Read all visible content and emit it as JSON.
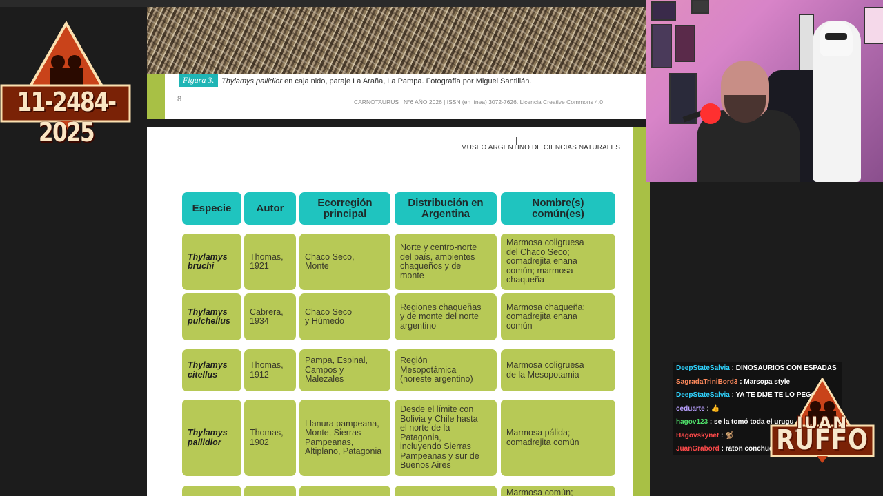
{
  "overlay": {
    "phone_number": "11-2484-2025",
    "channel_logo": {
      "line1": "JUAN",
      "line2": "RUFFO"
    }
  },
  "document_top": {
    "figure_label": "Figura 3.",
    "caption_species": "Thylamys pallidior",
    "caption_rest": " en caja nido, paraje La Araña, La Pampa. Fotografía por Miguel Santillán.",
    "page_number": "8",
    "footer": "CARNOTAURUS | N°6 AÑO 2026 | ISSN (en línea) 3072-7626. Licencia Creative Commons 4.0"
  },
  "document_main": {
    "museum": "MUSEO ARGENTINO DE CIENCIAS NATURALES",
    "table": {
      "headers": [
        "Especie",
        "Autor",
        "Ecorregión\nprincipal",
        "Distribución en\nArgentina",
        "Nombre(s)\ncomún(es)"
      ],
      "rows": [
        {
          "species": "Thylamys\nbruchi",
          "author": "Thomas,\n1921",
          "ecoregion": "Chaco Seco,\nMonte",
          "distribution": "Norte y centro-norte\ndel país, ambientes\nchaqueños y de\nmonte",
          "common": "Marmosa coligruesa\ndel Chaco Seco;\ncomadrejita enana\ncomún; marmosa\nchaqueña"
        },
        {
          "species": "Thylamys\npulchellus",
          "author": "Cabrera,\n1934",
          "ecoregion": "Chaco Seco\ny Húmedo",
          "distribution": "Regiones chaqueñas\ny de monte del norte\nargentino",
          "common": "Marmosa chaqueña;\ncomadrejita enana\ncomún"
        },
        {
          "species": "Thylamys\ncitellus",
          "author": "Thomas,\n1912",
          "ecoregion": "Pampa, Espinal,\nCampos y\nMalezales",
          "distribution": "Región\nMesopotámica\n(noreste argentino)",
          "common": "Marmosa coligruesa\nde la Mesopotamia"
        },
        {
          "species": "Thylamys\npallidior",
          "author": "Thomas,\n1902",
          "ecoregion": "Llanura pampeana,\nMonte, Sierras\nPampeanas,\nAltiplano, Patagonia",
          "distribution": "Desde el límite con\nBolivia y Chile hasta\nel norte de la\nPatagonia,\nincluyendo Sierras\nPampeanas y sur de\nBuenos Aires",
          "common": "Marmosa pálida;\ncomadrejita común"
        },
        {
          "species": "",
          "author": "",
          "ecoregion": "",
          "distribution": "",
          "common": "Marmosa común;"
        }
      ]
    }
  },
  "chat": [
    {
      "user": "DeepStateSalvia",
      "color": "#2fd4ff",
      "message": "DINOSAURIOS CON ESPADAS"
    },
    {
      "user": "SagradaTriniBord3",
      "color": "#ff8a5c",
      "message": "Marsopa style"
    },
    {
      "user": "DeepStateSalvia",
      "color": "#2fd4ff",
      "message": "YA TE DIJE TE LO PEGO"
    },
    {
      "user": "ceduarte",
      "color": "#b9a0ff",
      "message": "👍"
    },
    {
      "user": "hagov123",
      "color": "#4fe06a",
      "message": "se la tomó toda el urugu"
    },
    {
      "user": "Hagovskynet",
      "color": "#ff4a4a",
      "message": "🐒"
    },
    {
      "user": "JuanGrabord",
      "color": "#ff4a4a",
      "message": "raton conchud"
    }
  ],
  "colors": {
    "header_teal": "#1fc4bf",
    "cell_green": "#b7c956",
    "side_green": "#a8c045"
  }
}
